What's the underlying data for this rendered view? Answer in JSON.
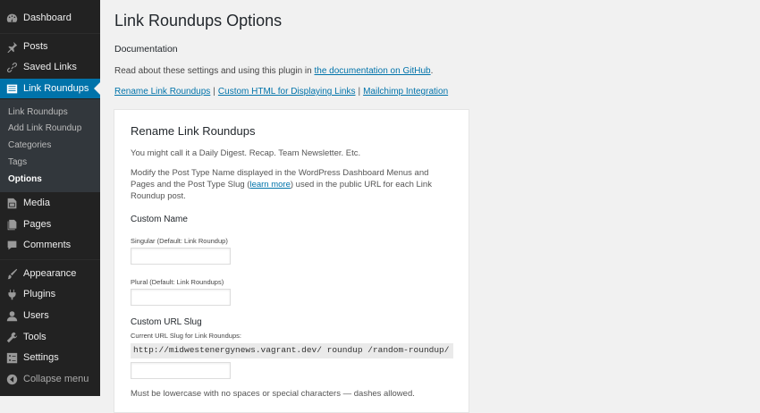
{
  "sidebar": {
    "dashboard": "Dashboard",
    "posts": "Posts",
    "saved_links": "Saved Links",
    "link_roundups": "Link Roundups",
    "submenu": [
      "Link Roundups",
      "Add Link Roundup",
      "Categories",
      "Tags",
      "Options"
    ],
    "media": "Media",
    "pages": "Pages",
    "comments": "Comments",
    "appearance": "Appearance",
    "plugins": "Plugins",
    "users": "Users",
    "tools": "Tools",
    "settings": "Settings",
    "collapse": "Collapse menu"
  },
  "page": {
    "title": "Link Roundups Options",
    "doc_heading": "Documentation",
    "doc_text": "Read about these settings and using this plugin in ",
    "doc_link": "the documentation on GitHub",
    "doc_end": ".",
    "quick_links": [
      "Rename Link Roundups",
      "Custom HTML for Displaying Links",
      "Mailchimp Integration"
    ],
    "separator": "|"
  },
  "card": {
    "title": "Rename Link Roundups",
    "intro": "You might call it a Daily Digest. Recap. Team Newsletter. Etc.",
    "desc_before": "Modify the Post Type Name displayed in the WordPress Dashboard Menus and Pages and the Post Type Slug (",
    "desc_link": "learn more",
    "desc_after": ") used in the public URL for each Link Roundup post.",
    "custom_name_label": "Custom Name",
    "singular_label": "Singular (Default: Link Roundup)",
    "singular_value": "",
    "plural_label": "Plural (Default: Link Roundups)",
    "plural_value": "",
    "slug_label": "Custom URL Slug",
    "current_slug_label": "Current URL Slug for Link Roundups:",
    "current_slug": "http://midwestenergynews.vagrant.dev/ roundup /random-roundup/",
    "slug_value": "",
    "slug_note": "Must be lowercase with no spaces or special characters — dashes allowed."
  },
  "colors": {
    "sidebar_bg": "#222222",
    "submenu_bg": "#32373c",
    "accent": "#0073aa",
    "page_bg": "#f1f1f1"
  }
}
